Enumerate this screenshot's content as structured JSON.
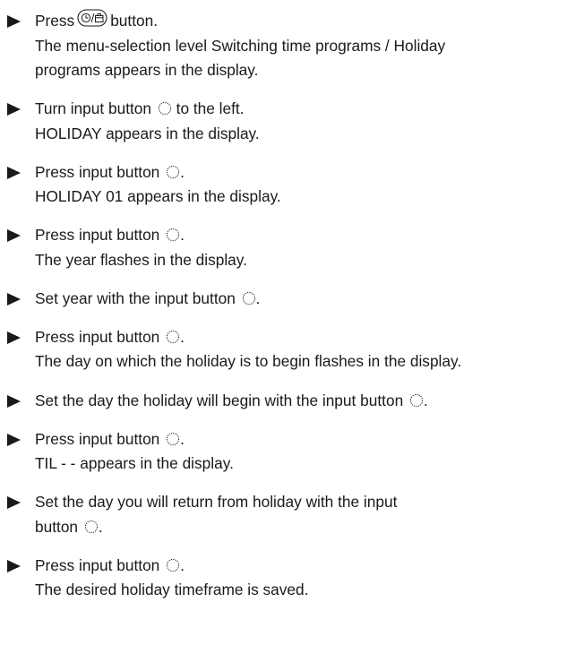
{
  "steps": [
    {
      "pre": "Press",
      "icon": "clock-holiday-button-icon",
      "post": "button.",
      "result": [
        "The menu-selection level Switching time programs / Holiday",
        "programs appears in the display."
      ]
    },
    {
      "pre": "Turn input button",
      "icon": "input-knob-icon",
      "post": "to the left.",
      "result": [
        "HOLIDAY appears in the display."
      ]
    },
    {
      "pre": "Press input button",
      "icon": "input-knob-icon",
      "post": ".",
      "result": [
        "HOLIDAY 01 appears in the display."
      ]
    },
    {
      "pre": "Press input button",
      "icon": "input-knob-icon",
      "post": ".",
      "result": [
        "The year flashes in the display."
      ]
    },
    {
      "pre": "Set year with the input button",
      "icon": "input-knob-icon",
      "post": ".",
      "result": []
    },
    {
      "pre": "Press input button",
      "icon": "input-knob-icon",
      "post": ".",
      "result": [
        "The day on which the holiday is to begin flashes in the display."
      ]
    },
    {
      "pre": "Set the day the holiday will begin with the input button",
      "icon": "input-knob-icon",
      "post": ".",
      "result": []
    },
    {
      "pre": "Press input button",
      "icon": "input-knob-icon",
      "post": ".",
      "result": [
        "TIL - - appears in the display."
      ]
    },
    {
      "pre": "Set the day you will return from holiday with the input",
      "pre2": "button",
      "icon": "input-knob-icon",
      "post": ".",
      "result": []
    },
    {
      "pre": "Press input button",
      "icon": "input-knob-icon",
      "post": ".",
      "result": [
        "The desired holiday timeframe is saved."
      ]
    }
  ]
}
